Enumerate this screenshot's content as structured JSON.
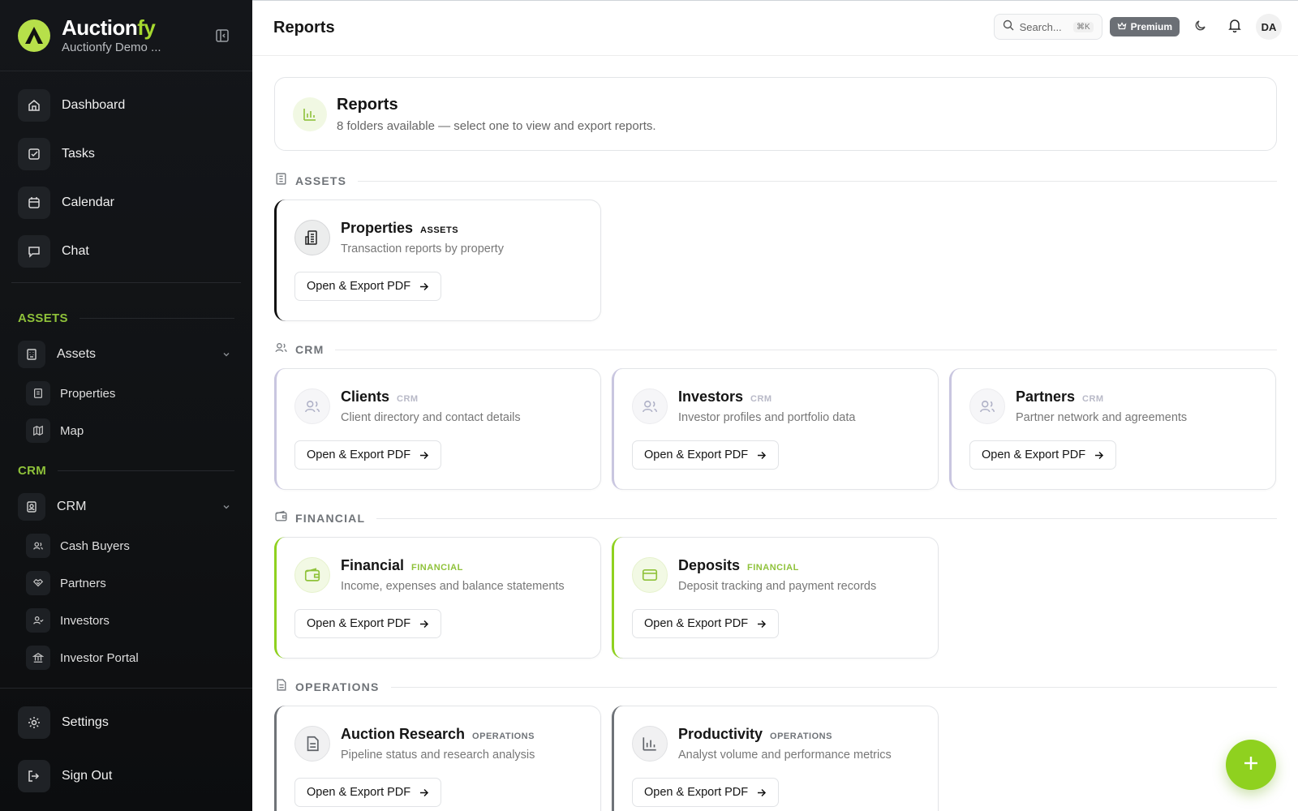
{
  "brand": {
    "name_main": "Auction",
    "name_accent": "fy",
    "subtitle": "Auctionfy Demo ..."
  },
  "sidebar": {
    "main": [
      {
        "label": "Dashboard",
        "icon": "home-icon"
      },
      {
        "label": "Tasks",
        "icon": "checkbox-icon"
      },
      {
        "label": "Calendar",
        "icon": "calendar-icon"
      },
      {
        "label": "Chat",
        "icon": "chat-icon"
      }
    ],
    "sections": [
      {
        "title": "ASSETS",
        "group": "Assets",
        "items": [
          "Properties",
          "Map"
        ]
      },
      {
        "title": "CRM",
        "group": "CRM",
        "items": [
          "Cash Buyers",
          "Partners",
          "Investors",
          "Investor Portal"
        ]
      }
    ],
    "bottom": [
      {
        "label": "Settings"
      },
      {
        "label": "Sign Out"
      }
    ]
  },
  "topbar": {
    "title": "Reports",
    "search_placeholder": "Search...",
    "shortcut": "⌘K",
    "premium": "Premium",
    "avatar": "DA"
  },
  "hero": {
    "title": "Reports",
    "subtitle": "8 folders available — select one to view and export reports."
  },
  "colors": {
    "accent_green": "#8fd11f",
    "tag_green": "#8fc23a",
    "crm_purple": "#c9c6e0",
    "sidebar_bg": "#121417"
  },
  "sections": [
    {
      "name": "ASSETS",
      "cards": [
        {
          "title": "Properties",
          "tag": "ASSETS",
          "desc": "Transaction reports by property",
          "button": "Open & Export PDF"
        }
      ]
    },
    {
      "name": "CRM",
      "cards": [
        {
          "title": "Clients",
          "tag": "CRM",
          "desc": "Client directory and contact details",
          "button": "Open & Export PDF"
        },
        {
          "title": "Investors",
          "tag": "CRM",
          "desc": "Investor profiles and portfolio data",
          "button": "Open & Export PDF"
        },
        {
          "title": "Partners",
          "tag": "CRM",
          "desc": "Partner network and agreements",
          "button": "Open & Export PDF"
        }
      ]
    },
    {
      "name": "FINANCIAL",
      "cards": [
        {
          "title": "Financial",
          "tag": "FINANCIAL",
          "desc": "Income, expenses and balance statements",
          "button": "Open & Export PDF"
        },
        {
          "title": "Deposits",
          "tag": "FINANCIAL",
          "desc": "Deposit tracking and payment records",
          "button": "Open & Export PDF"
        }
      ]
    },
    {
      "name": "OPERATIONS",
      "cards": [
        {
          "title": "Auction Research",
          "tag": "OPERATIONS",
          "desc": "Pipeline status and research analysis",
          "button": "Open & Export PDF"
        },
        {
          "title": "Productivity",
          "tag": "OPERATIONS",
          "desc": "Analyst volume and performance metrics",
          "button": "Open & Export PDF"
        }
      ]
    }
  ]
}
